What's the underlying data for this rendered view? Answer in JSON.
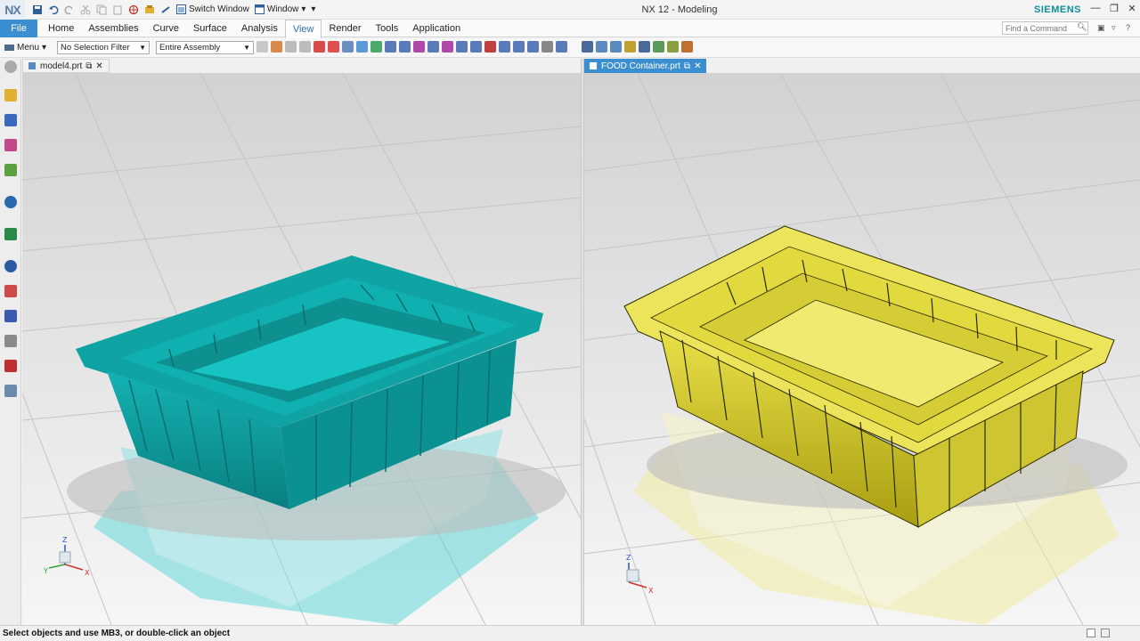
{
  "app": {
    "logo": "NX",
    "title": "NX 12 - Modeling",
    "brand": "SIEMENS"
  },
  "quick_access": {
    "switch_window": "Switch Window",
    "window": "Window"
  },
  "ribbon": {
    "file": "File",
    "tabs": [
      "Home",
      "Assemblies",
      "Curve",
      "Surface",
      "Analysis",
      "View",
      "Render",
      "Tools",
      "Application"
    ],
    "active_tab": "View",
    "command_search_placeholder": "Find a Command"
  },
  "toolbar": {
    "menu_label": "Menu",
    "selection_filter": "No Selection Filter",
    "assembly_scope": "Entire Assembly"
  },
  "viewports": [
    {
      "tab_label": "model4.prt",
      "active": false,
      "part_color": "#13a5a6"
    },
    {
      "tab_label": "FOOD Container.prt",
      "active": true,
      "part_color": "#ece45a"
    }
  ],
  "status": {
    "message": "Select objects and use MB3, or double-click an object"
  },
  "colors": {
    "ribbon_accent": "#3b8fd1",
    "active_tab_text": "#2c6fb7",
    "brand": "#0f8f9a"
  }
}
